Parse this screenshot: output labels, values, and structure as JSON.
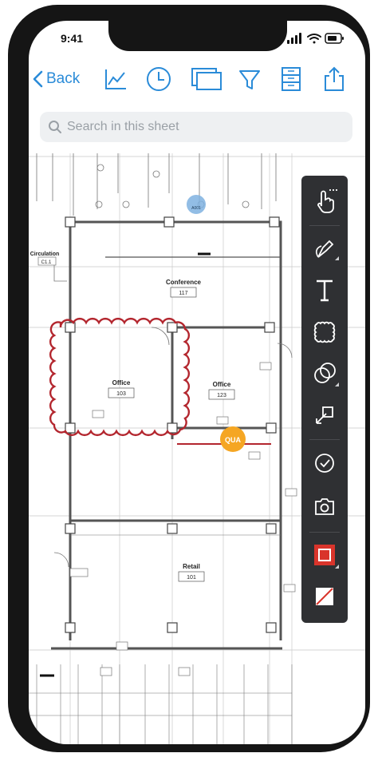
{
  "status_bar": {
    "time": "9:41"
  },
  "toolbar": {
    "back_label": "Back",
    "icons": [
      "chart-icon",
      "clock-icon",
      "sheets-icon",
      "filter-icon",
      "layers-icon",
      "share-icon"
    ],
    "accent_color": "#2a8bd8"
  },
  "search": {
    "placeholder": "Search in this sheet",
    "value": ""
  },
  "drawing": {
    "rooms": [
      {
        "name": "Conference",
        "number": "117"
      },
      {
        "name": "Office",
        "number": "103"
      },
      {
        "name": "Office",
        "number": "123"
      },
      {
        "name": "Retail",
        "number": "101"
      },
      {
        "name": "Circulation",
        "number": "C1.1"
      }
    ],
    "markers": [
      {
        "label": "QUA",
        "color": "#f5a623"
      },
      {
        "label": "A001",
        "color": "#7fb2e0"
      }
    ],
    "cloud_color": "#b3262e"
  },
  "tool_panel": {
    "tools": [
      "touch-icon",
      "pen-icon",
      "text-icon",
      "cloud-shape-icon",
      "shapes-icon",
      "crop-icon",
      "check-icon",
      "camera-icon",
      "stroke-color-icon",
      "fill-color-icon"
    ],
    "stroke_color": "#d9342b"
  }
}
